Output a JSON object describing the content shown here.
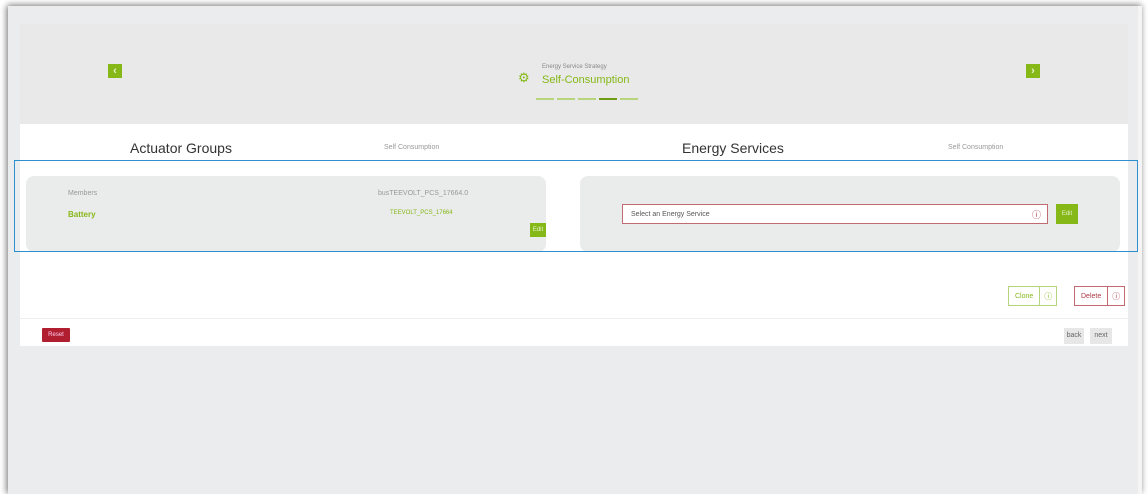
{
  "header": {
    "prev_icon": "chevron-left-icon",
    "prev_glyph": "‹",
    "next_icon": "chevron-right-icon",
    "next_glyph": "›",
    "gear_icon": "gear-icon",
    "gear_glyph": "⚙",
    "strategy_label": "Energy Service Strategy",
    "strategy_title": "Self-Consumption",
    "steps": 5,
    "active_step": 4
  },
  "sections": {
    "actuator_title": "Actuator Groups",
    "actuator_sub": "Self Consumption",
    "energy_title": "Energy Services",
    "energy_sub": "Self Consumption"
  },
  "actuator_card": {
    "members_label": "Members",
    "members_value": "busTEEVOLT_PCS_17664.0",
    "battery_label": "Battery",
    "battery_id": "TEEVOLT_PCS_17664",
    "edit_label": "Edit"
  },
  "energy_card": {
    "select_placeholder": "Select an Energy Service",
    "select_icon": "info-circle-icon",
    "select_icon_glyph": "ⓘ",
    "select_button_label": "Edit"
  },
  "actions": {
    "clone_label": "Clone",
    "clone_icon_glyph": "ⓘ",
    "delete_label": "Delete",
    "delete_icon_glyph": "ⓘ"
  },
  "footer": {
    "reset_label": "Reset",
    "back_label": "back",
    "next_label": "next"
  },
  "colors": {
    "accent": "#86b818",
    "danger": "#b01e30",
    "highlight": "#2d8fce"
  }
}
